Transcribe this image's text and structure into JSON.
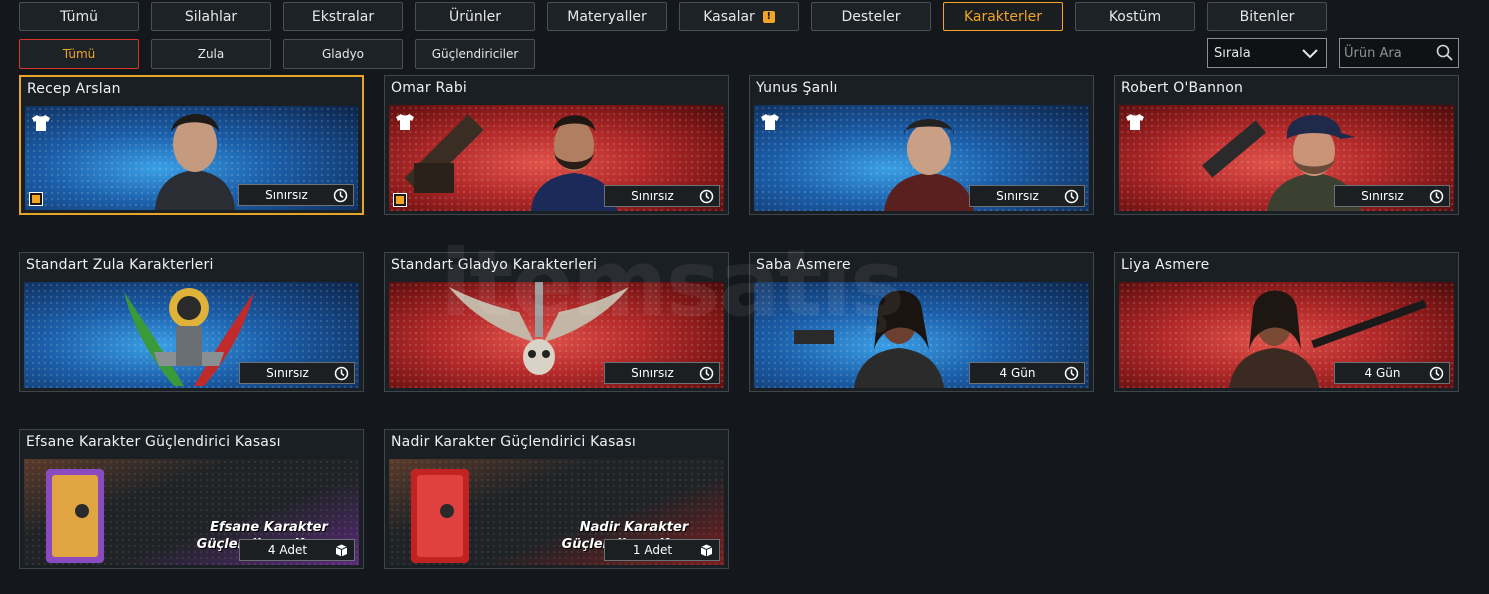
{
  "tabs": [
    {
      "label": "Tümü"
    },
    {
      "label": "Silahlar"
    },
    {
      "label": "Ekstralar"
    },
    {
      "label": "Ürünler"
    },
    {
      "label": "Materyaller"
    },
    {
      "label": "Kasalar",
      "badge": "!"
    },
    {
      "label": "Desteler"
    },
    {
      "label": "Karakterler",
      "active": true
    },
    {
      "label": "Kostüm"
    },
    {
      "label": "Bitenler"
    }
  ],
  "subtabs": [
    {
      "label": "Tümü",
      "active": true
    },
    {
      "label": "Zula"
    },
    {
      "label": "Gladyo"
    },
    {
      "label": "Güçlendiriciler"
    }
  ],
  "sort": {
    "label": "Sırala"
  },
  "search": {
    "placeholder": "Ürün Ara"
  },
  "watermark": "itemsatış",
  "cards": [
    {
      "title": "Recep Arslan",
      "tag": "Sınırsız",
      "theme": "blue",
      "tag_icon": "clock-icon"
    },
    {
      "title": "Omar Rabi",
      "tag": "Sınırsız",
      "theme": "red",
      "tag_icon": "clock-icon"
    },
    {
      "title": "Yunus Şanlı",
      "tag": "Sınırsız",
      "theme": "blue",
      "tag_icon": "clock-icon"
    },
    {
      "title": "Robert O'Bannon",
      "tag": "Sınırsız",
      "theme": "red",
      "tag_icon": "clock-icon"
    },
    {
      "title": "Standart Zula Karakterleri",
      "tag": "Sınırsız",
      "theme": "blue",
      "tag_icon": "clock-icon"
    },
    {
      "title": "Standart Gladyo Karakterleri",
      "tag": "Sınırsız",
      "theme": "red",
      "tag_icon": "clock-icon"
    },
    {
      "title": "Saba Asmere",
      "tag": "4 Gün",
      "theme": "blue",
      "tag_icon": "clock-icon"
    },
    {
      "title": "Liya Asmere",
      "tag": "4 Gün",
      "theme": "red",
      "tag_icon": "clock-icon"
    },
    {
      "title": "Efsane Karakter Güçlendirici Kasası",
      "tag": "4 Adet",
      "tag_icon": "box-icon",
      "crate_line1": "Efsane Karakter",
      "crate_line2": "Güçlendirme  Kasası"
    },
    {
      "title": "Nadir Karakter Güçlendirici Kasası",
      "tag": "1 Adet",
      "tag_icon": "box-icon",
      "crate_line1": "Nadir Karakter",
      "crate_line2": "Güçlendirme  Kasası"
    }
  ],
  "colors": {
    "accent": "#f0a526",
    "alert": "#d6372b",
    "blue_bg": "#1b5ea9",
    "red_bg": "#b42a2a"
  }
}
